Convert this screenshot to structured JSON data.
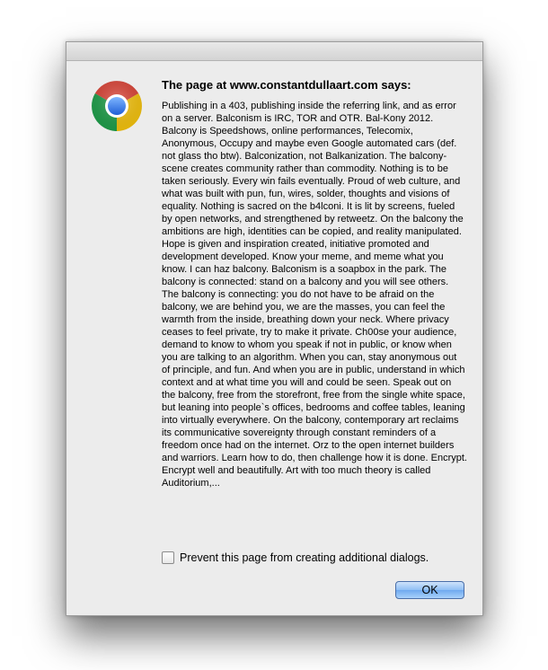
{
  "dialog": {
    "heading": "The page at www.constantdullaart.com says:",
    "app_icon": "chrome-logo-icon",
    "message": "Publishing in a 403, publishing inside the referring link, and as error on a server. Balconism is IRC, TOR and OTR. Bal-Kony 2012. Balcony is Speedshows, online performances, Telecomix, Anonymous, Occupy and maybe even Google automated cars (def. not glass tho btw). Balconization, not Balkanization. The balcony-scene creates community rather than commodity. Nothing is to be taken seriously. Every win fails eventually. Proud of web culture, and what was built with pun, fun, wires, solder, thoughts and visions of equality. Nothing is sacred on the b4lconi. It is lit by screens, fueled by open networks, and strengthened by retweetz. On the balcony the ambitions are high, identities can be copied, and reality manipulated. Hope is given and inspiration created, initiative promoted and development developed. Know your meme, and meme what you know. I can haz balcony. Balconism is a soapbox in the park. The balcony is connected: stand on a balcony and you will see others. The balcony is connecting: you do not have to be afraid on the balcony, we are behind you, we are the masses, you can feel the warmth from the inside, breathing down your neck. Where privacy ceases to feel private, try to make it private. Ch00se your audience, demand to know to whom you speak if not in public, or know when you are talking to an algorithm. When you can, stay anonymous out of principle, and fun. And when you are in public, understand in which context and at what time you will and could be seen. Speak out on the balcony, free from the storefront, free from the single white space, but leaning into people`s offices, bedrooms and coffee tables, leaning into virtually everywhere. On the balcony, contemporary art reclaims its communicative sovereignty through constant reminders of a freedom once had on the internet. Orz to the open internet builders and warriors. Learn how to do, then challenge how it is done. Encrypt. Encrypt well and beautifully. Art with too much theory is called Auditorium,...",
    "checkbox_label": "Prevent this page from creating additional dialogs.",
    "checkbox_checked": false,
    "ok_label": "OK"
  },
  "colors": {
    "dialog_bg": "#ececec",
    "button_blue": "#8fbff5"
  }
}
